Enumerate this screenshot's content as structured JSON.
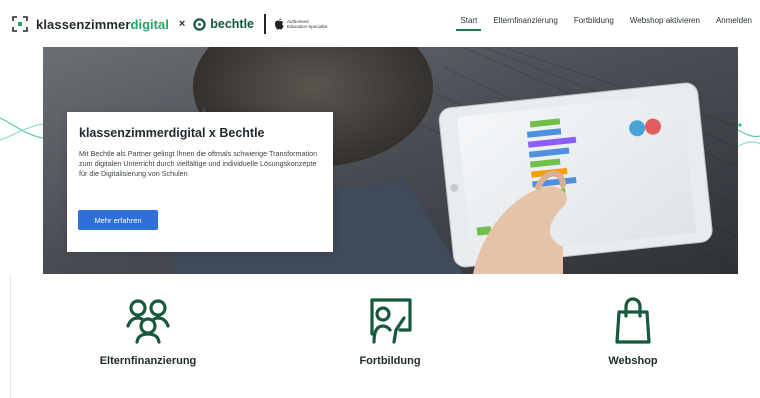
{
  "header": {
    "brand_part1": "klassenzimmer",
    "brand_part2": "digital",
    "separator": "×",
    "partner": "bechtle",
    "apple_badge_line1": "Authorised",
    "apple_badge_line2": "Education Specialist",
    "nav": [
      {
        "label": "Start",
        "active": true
      },
      {
        "label": "Elternfinanzierung",
        "active": false
      },
      {
        "label": "Fortbildung",
        "active": false
      },
      {
        "label": "Webshop aktivieren",
        "active": false
      },
      {
        "label": "Anmelden",
        "active": false
      }
    ]
  },
  "hero": {
    "title": "klassenzimmerdigital x Bechtle",
    "text": "Mit Bechtle als Partner gelingt Ihnen die oftmals schwierige Transformation zum digitalen Unterricht durch vielfältige und individuelle Lösungskonzepte für die Digitalisierung von Schulen",
    "button_label": "Mehr erfahren"
  },
  "features": [
    {
      "label": "Elternfinanzierung",
      "icon": "people-icon"
    },
    {
      "label": "Fortbildung",
      "icon": "teacher-board-icon"
    },
    {
      "label": "Webshop",
      "icon": "shopping-bag-icon"
    }
  ],
  "colors": {
    "brand_green": "#1ea66b",
    "dark_green": "#0f5a3a",
    "icon_green": "#17593c",
    "button_blue": "#2f6fd8"
  }
}
